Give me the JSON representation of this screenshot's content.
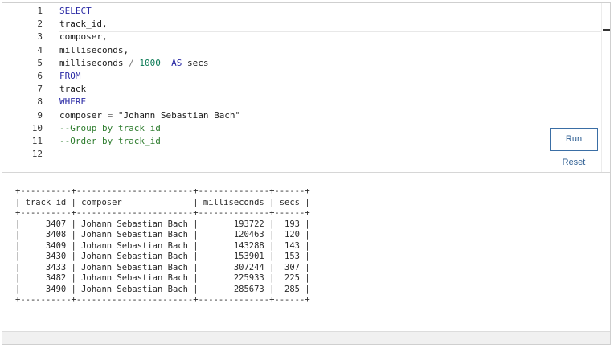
{
  "editor": {
    "line_numbers": [
      "1",
      "2",
      "3",
      "4",
      "5",
      "6",
      "7",
      "8",
      "9",
      "10",
      "11",
      "12"
    ],
    "lines": [
      {
        "tokens": [
          {
            "t": "kw",
            "v": "SELECT"
          }
        ]
      },
      {
        "tokens": [
          {
            "t": "plain",
            "v": "track_id,"
          }
        ]
      },
      {
        "tokens": [
          {
            "t": "plain",
            "v": "composer,"
          }
        ]
      },
      {
        "tokens": [
          {
            "t": "plain",
            "v": "milliseconds,"
          }
        ]
      },
      {
        "tokens": [
          {
            "t": "plain",
            "v": "milliseconds "
          },
          {
            "t": "op",
            "v": "/"
          },
          {
            "t": "plain",
            "v": " "
          },
          {
            "t": "num",
            "v": "1000"
          },
          {
            "t": "plain",
            "v": "  "
          },
          {
            "t": "kw",
            "v": "AS"
          },
          {
            "t": "plain",
            "v": " secs"
          }
        ]
      },
      {
        "tokens": [
          {
            "t": "kw",
            "v": "FROM"
          }
        ]
      },
      {
        "tokens": [
          {
            "t": "plain",
            "v": "track"
          }
        ]
      },
      {
        "tokens": [
          {
            "t": "kw",
            "v": "WHERE"
          }
        ]
      },
      {
        "tokens": [
          {
            "t": "plain",
            "v": "composer "
          },
          {
            "t": "op",
            "v": "="
          },
          {
            "t": "plain",
            "v": " "
          },
          {
            "t": "str",
            "v": "\"Johann Sebastian Bach\""
          }
        ]
      },
      {
        "tokens": [
          {
            "t": "cmt",
            "v": "--Group by track_id"
          }
        ]
      },
      {
        "tokens": [
          {
            "t": "cmt",
            "v": "--Order by track_id"
          }
        ]
      },
      {
        "tokens": []
      }
    ]
  },
  "controls": {
    "run_label": "Run",
    "reset_label": "Reset"
  },
  "result": {
    "columns": [
      "track_id",
      "composer",
      "milliseconds",
      "secs"
    ],
    "rows": [
      [
        "3407",
        "Johann Sebastian Bach",
        "193722",
        "193"
      ],
      [
        "3408",
        "Johann Sebastian Bach",
        "120463",
        "120"
      ],
      [
        "3409",
        "Johann Sebastian Bach",
        "143288",
        "143"
      ],
      [
        "3430",
        "Johann Sebastian Bach",
        "153901",
        "153"
      ],
      [
        "3433",
        "Johann Sebastian Bach",
        "307244",
        "307"
      ],
      [
        "3482",
        "Johann Sebastian Bach",
        "225933",
        "225"
      ],
      [
        "3490",
        "Johann Sebastian Bach",
        "285673",
        "285"
      ]
    ]
  },
  "colors": {
    "keyword": "#2a2aa5",
    "number": "#0a7a55",
    "comment": "#2f7d2f",
    "button_border": "#3a6ea5"
  }
}
